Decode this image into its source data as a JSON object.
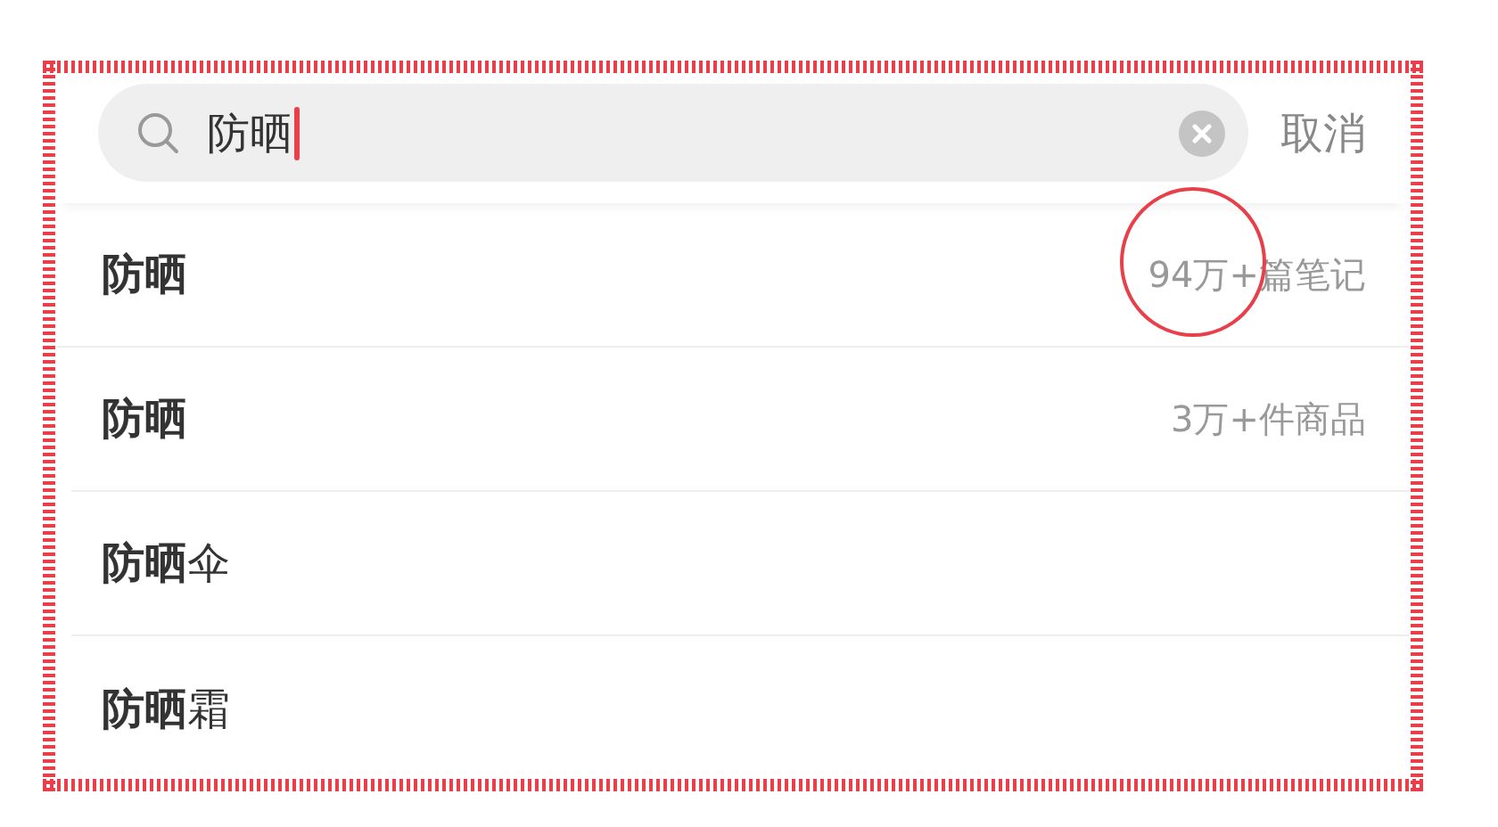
{
  "search": {
    "value": "防晒",
    "cancel": "取消"
  },
  "suggestions": [
    {
      "text": "防晒",
      "count": "94万+篇笔记",
      "circled": true
    },
    {
      "text": "防晒",
      "count": "3万+件商品",
      "circled": false
    },
    {
      "text": "**防晒**伞"
    },
    {
      "text": "**防晒**霜"
    }
  ]
}
